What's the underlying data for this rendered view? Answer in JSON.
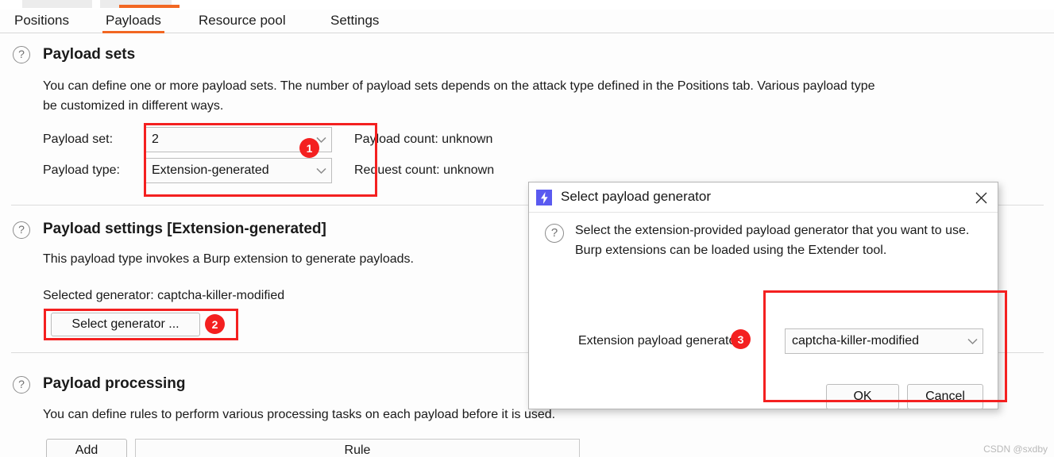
{
  "tabs": [
    {
      "label": "Positions",
      "active": false
    },
    {
      "label": "Payloads",
      "active": true
    },
    {
      "label": "Resource pool",
      "active": false
    },
    {
      "label": "Settings",
      "active": false
    }
  ],
  "payload_sets": {
    "title": "Payload sets",
    "help_icon": "question-mark-icon",
    "description_line1": "You can define one or more payload sets. The number of payload sets depends on the attack type defined in the Positions tab. Various payload type",
    "description_line2": "be customized in different ways.",
    "payload_set_label": "Payload set:",
    "payload_set_value": "2",
    "payload_type_label": "Payload type:",
    "payload_type_value": "Extension-generated",
    "payload_count": "Payload count: unknown",
    "request_count": "Request count: unknown"
  },
  "payload_settings": {
    "title": "Payload settings [Extension-generated]",
    "help_icon": "question-mark-icon",
    "description": "This payload type invokes a Burp extension to generate payloads.",
    "selected_generator": "Selected generator: captcha-killer-modified",
    "select_generator_button": "Select generator ..."
  },
  "payload_processing": {
    "title": "Payload processing",
    "help_icon": "question-mark-icon",
    "description": "You can define rules to perform various processing tasks on each payload before it is used.",
    "add_button": "Add",
    "rule_column_header": "Rule"
  },
  "dialog": {
    "app_icon": "burp-lightning-icon",
    "title": "Select payload generator",
    "close_icon": "close-icon",
    "help_icon": "question-mark-icon",
    "body_text": "Select the extension-provided payload generator that you want to use. Burp extensions can be loaded using the Extender tool.",
    "field_label": "Extension payload generator:",
    "generator_value": "captcha-killer-modified",
    "ok_button": "OK",
    "cancel_button": "Cancel"
  },
  "annotations": {
    "badge_1": "1",
    "badge_2": "2",
    "badge_3": "3",
    "color": "#f42020"
  },
  "watermark": "CSDN @sxdby",
  "colors": {
    "accent": "#f26722",
    "annotation": "#f42020",
    "burp_icon": "#5a5af0"
  }
}
